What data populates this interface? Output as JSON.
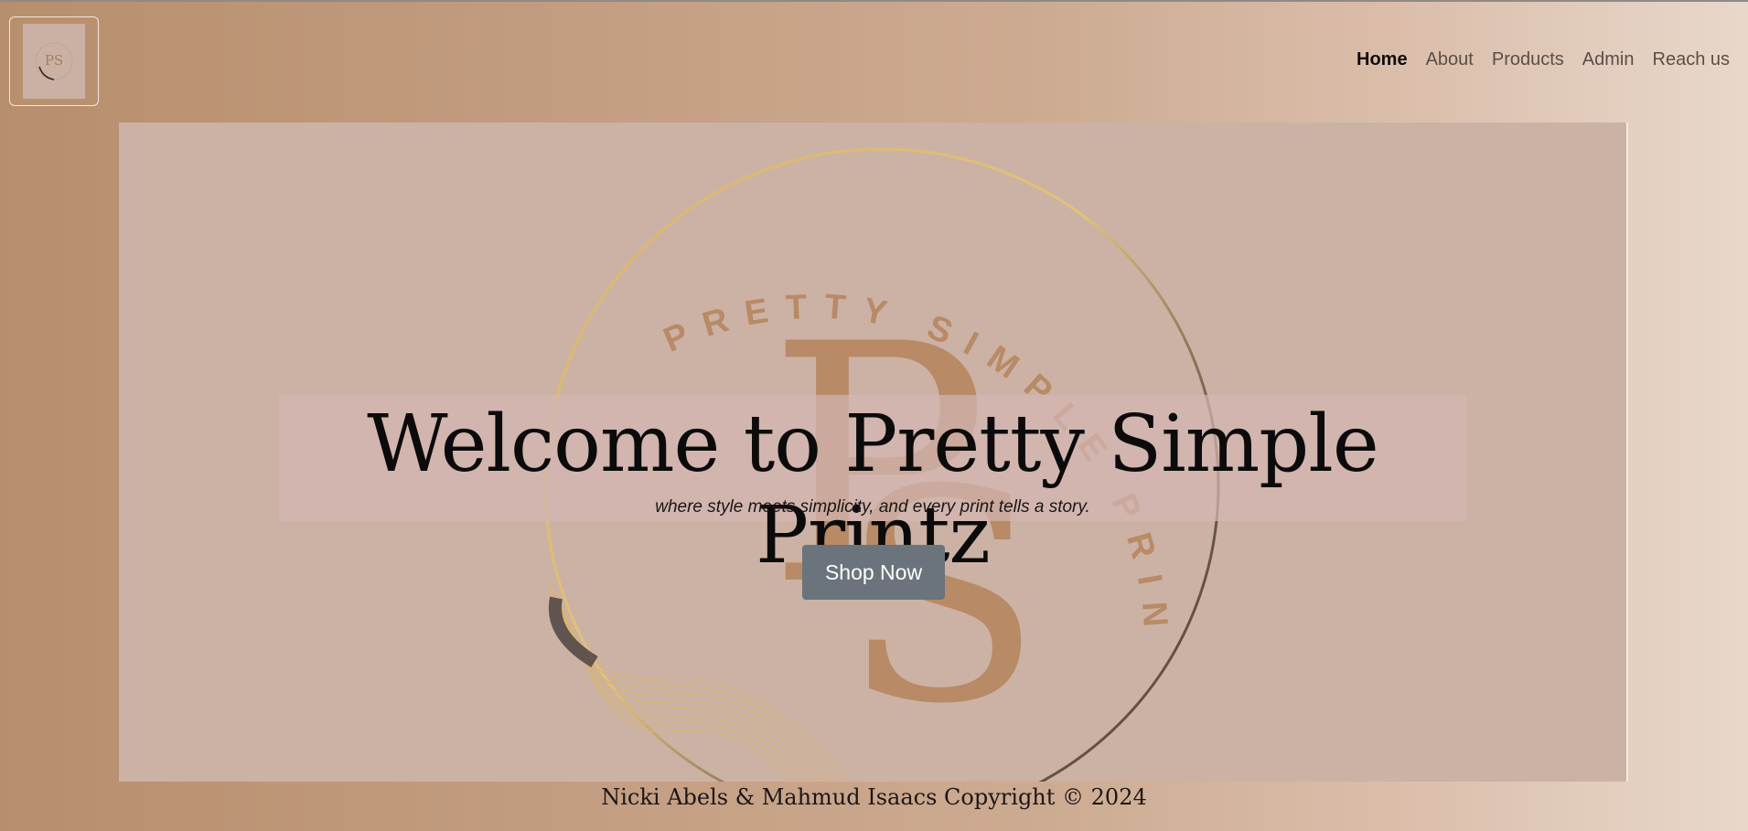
{
  "brand": {
    "logo_icon": "ps-monogram-logo",
    "logo_text": "PRETTY SIMPLE PRINTZ",
    "accent_color": "#b88a65"
  },
  "nav": {
    "items": [
      {
        "label": "Home",
        "active": true
      },
      {
        "label": "About",
        "active": false
      },
      {
        "label": "Products",
        "active": false
      },
      {
        "label": "Admin",
        "active": false
      },
      {
        "label": "Reach us",
        "active": false
      }
    ]
  },
  "hero": {
    "title": "Welcome to Pretty Simple Printz",
    "subtitle": "where style meets simplicity, and every print tells a story.",
    "cta_label": "Shop Now",
    "cta_color": "#6b747c"
  },
  "footer": {
    "text": "Nicki Abels & Mahmud Isaacs Copyright © 2024"
  }
}
